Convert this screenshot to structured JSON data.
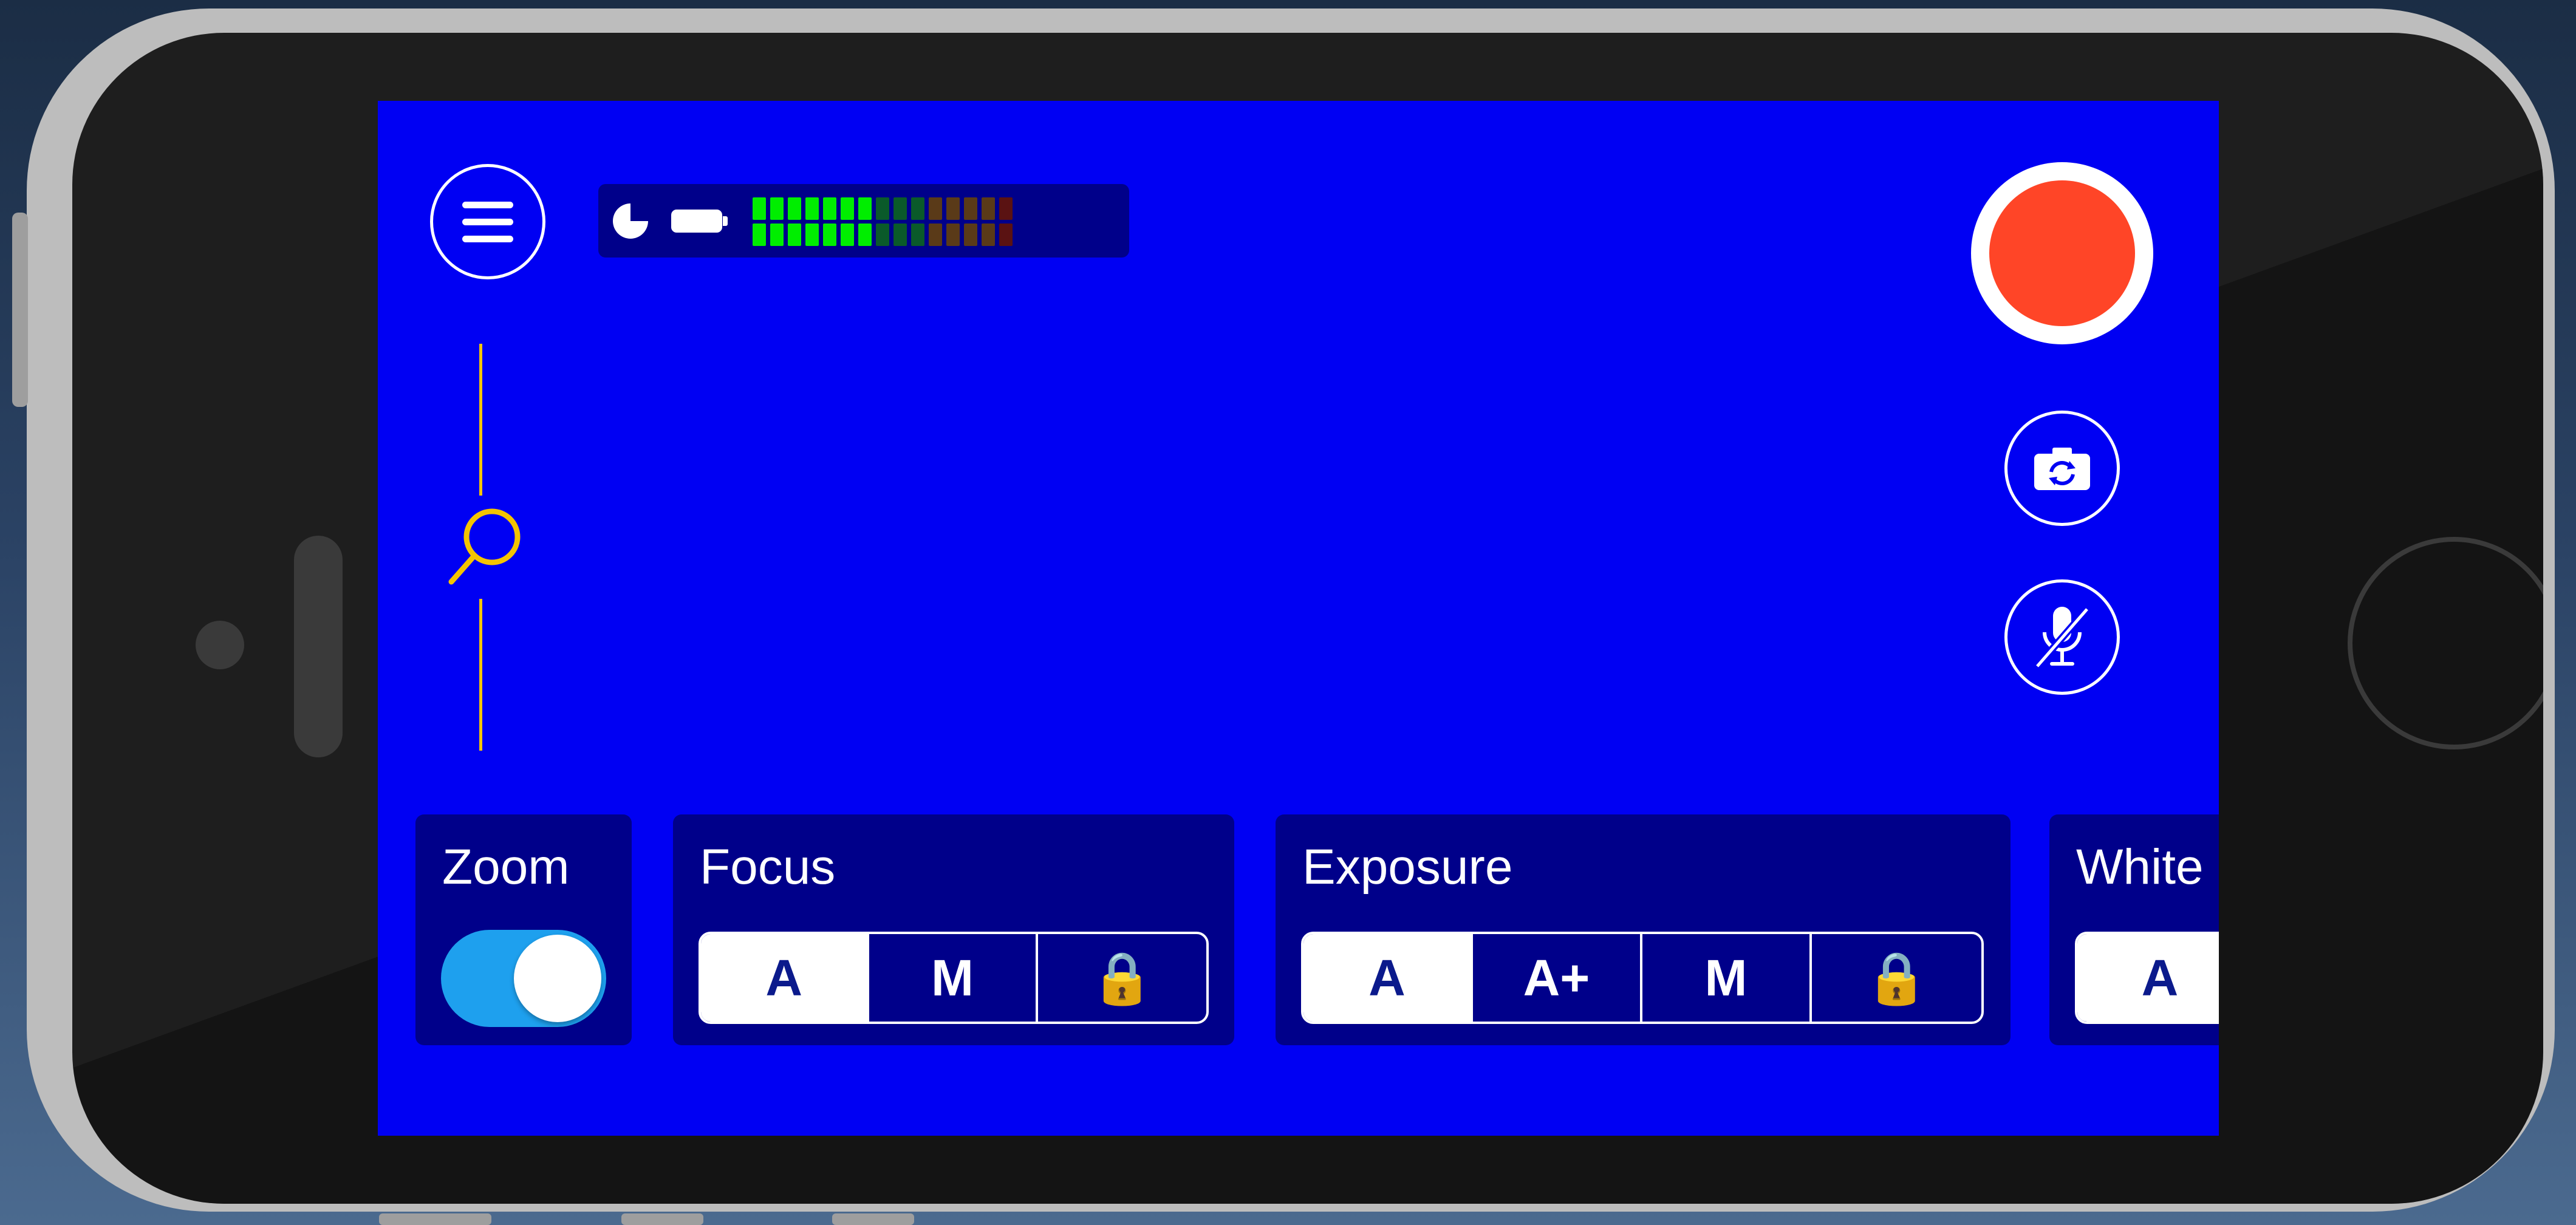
{
  "colors": {
    "screen_background": "#0000f3",
    "panel_background": "#00008a",
    "record": "#ff4527",
    "zoom_slider": "#f4c400",
    "toggle_on": "#1ea0ee",
    "meter_active": "#00ee00"
  },
  "icons": {
    "menu": "hamburger-menu-icon",
    "storage": "pie-storage-icon",
    "battery": "battery-icon",
    "zoom": "magnifier-icon",
    "switch_camera": "camera-rotate-icon",
    "microphone": "microphone-muted-icon"
  },
  "audio_meter": {
    "active_segments": 7,
    "total_segments": 15
  },
  "controls": {
    "zoom": {
      "label": "Zoom",
      "toggle_on": true
    },
    "focus": {
      "label": "Focus",
      "options": [
        "A",
        "M",
        "🔒"
      ],
      "selected": "A"
    },
    "exposure": {
      "label": "Exposure",
      "options": [
        "A",
        "A+",
        "M",
        "🔒"
      ],
      "selected": "A"
    },
    "white_balance": {
      "label": "White",
      "options": [
        "A"
      ],
      "selected": "A"
    }
  }
}
